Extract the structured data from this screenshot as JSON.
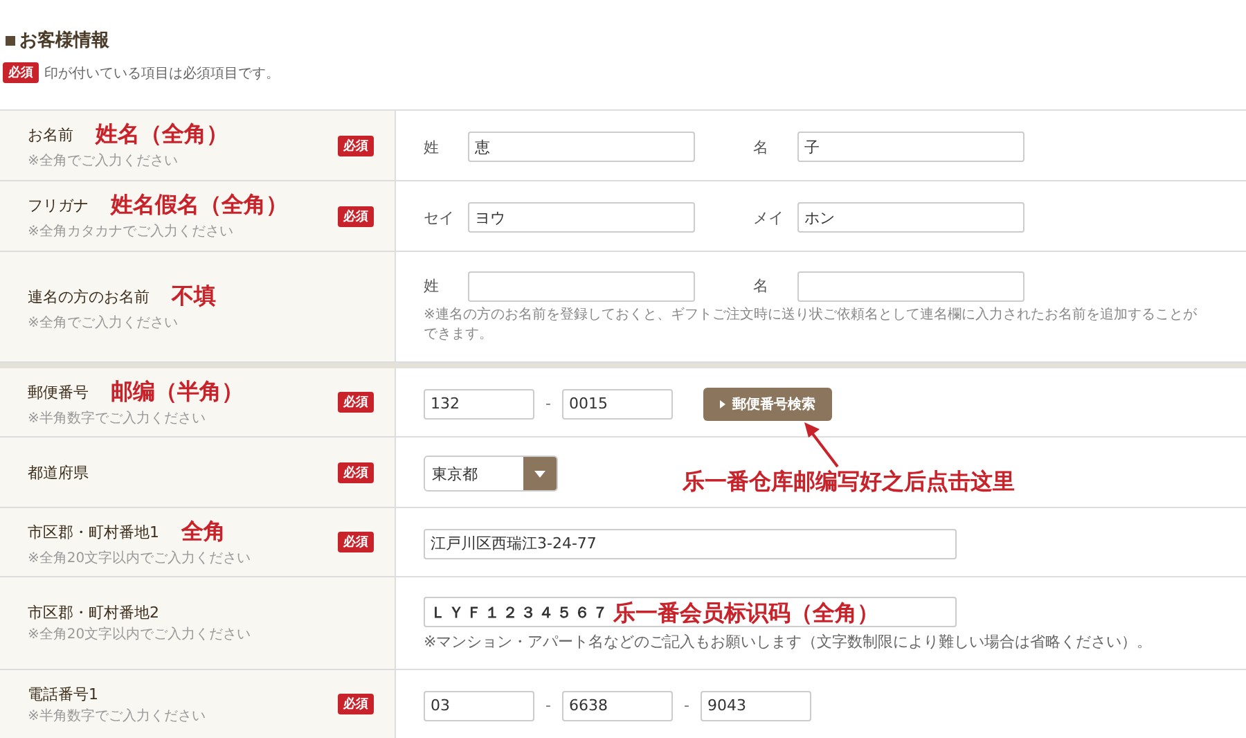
{
  "section_title": "お客様情報",
  "legend": {
    "badge": "必須",
    "text": "印が付いている項目は必須項目です。"
  },
  "rows": [
    {
      "kind": "pair",
      "label": "お名前",
      "hint": "※全角でご入力ください",
      "annotation": "姓名（全角）",
      "badge": "必須",
      "fields": [
        {
          "prefix": "姓",
          "value": "恵"
        },
        {
          "prefix": "名",
          "value": "子"
        }
      ]
    },
    {
      "kind": "pair",
      "label": "フリガナ",
      "hint": "※全角カタカナでご入力ください",
      "annotation": "姓名假名（全角）",
      "badge": "必須",
      "fields": [
        {
          "prefix": "セイ",
          "value": "ヨウ"
        },
        {
          "prefix": "メイ",
          "value": "ホン"
        }
      ]
    },
    {
      "kind": "pair",
      "label": "連名の方のお名前",
      "hint": "※全角でご入力ください",
      "annotation": "不填",
      "fields": [
        {
          "prefix": "姓"
        },
        {
          "prefix": "名"
        }
      ],
      "note": "※連名の方のお名前を登録しておくと、ギフトご注文時に送り状ご依頼名として連名欄に入力されたお名前を追加することができます。"
    },
    {
      "kind": "split",
      "label": "郵便番号",
      "hint": "※半角数字でご入力ください",
      "annotation": "邮编（半角）",
      "badge": "必須",
      "values": [
        "132",
        "0015"
      ],
      "separator": "-",
      "button": "郵便番号検索",
      "callout": "乐一番仓库邮编写好之后点击这里"
    },
    {
      "kind": "select",
      "label": "都道府県",
      "badge": "必須",
      "value": "東京都"
    },
    {
      "kind": "text",
      "label": "市区郡・町村番地1",
      "hint": "※全角20文字以内でご入力ください",
      "annotation": "全角",
      "badge": "必須",
      "value": "江戸川区西瑞江3-24-77"
    },
    {
      "kind": "text",
      "label": "市区郡・町村番地2",
      "hint": "※全角20文字以内でご入力ください",
      "value": "ＬＹＦ１２３４５６７",
      "field_annotation": "乐一番会员标识码（全角）",
      "note": "※マンション・アパート名などのご記入もお願いします（文字数制限により難しい場合は省略ください）。"
    },
    {
      "kind": "split",
      "label": "電話番号1",
      "hint": "※半角数字でご入力ください",
      "badge": "必須",
      "values": [
        "03",
        "6638",
        "9043"
      ],
      "separator": "-"
    }
  ]
}
